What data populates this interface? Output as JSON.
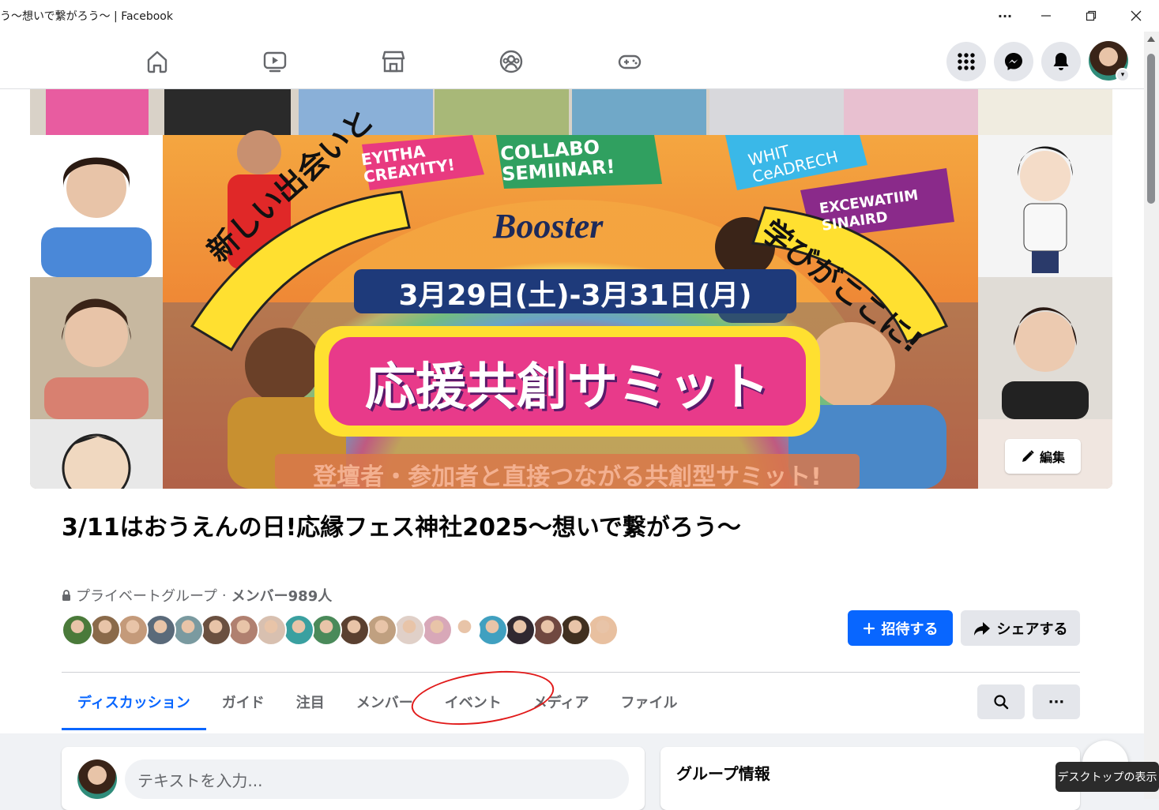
{
  "window": {
    "title": "う〜想いで繋がろう〜 | Facebook",
    "more": "···"
  },
  "navbar": {
    "icons": [
      "home-icon",
      "video-icon",
      "marketplace-icon",
      "groups-icon",
      "gaming-icon"
    ],
    "right_icons": [
      "menu-grid-icon",
      "messenger-icon",
      "bell-icon"
    ]
  },
  "cover": {
    "left_text": "新しい出会いと",
    "right_text": "学びがここに!",
    "logo": "Booster",
    "date": "3月29日(土)-3月31日(月)",
    "headline": "応援共創サミット",
    "subline": "登壇者・参加者と直接つながる共創型サミット!",
    "banner_texts": [
      "EYITHA CREAYITY!",
      "COLLABO SEMIINAR!",
      "WHIT CeADRECH",
      "EXCEWATIIM SINAIRD"
    ],
    "edit_label": "編集"
  },
  "group": {
    "title": "3/11はおうえんの日!応縁フェス神社2025〜想いで繋がろう〜",
    "privacy": "プライベートグループ",
    "separator": "·",
    "members": "メンバー989人",
    "member_colors": [
      "#4a7a3a",
      "#8a6a4a",
      "#c49a7a",
      "#5a6a7a",
      "#7a9aa0",
      "#6a5040",
      "#b08070",
      "#d8c0b0",
      "#3aa0a0",
      "#4a8a5a",
      "#5a4030",
      "#c0a080",
      "#e0d0c8",
      "#d8a8b8",
      "#ffffff",
      "#40a0c0",
      "#302830",
      "#704840",
      "#403020",
      "#e8c0a0"
    ]
  },
  "actions": {
    "invite": "招待する",
    "share": "シェアする"
  },
  "tabs": [
    {
      "label": "ディスカッション",
      "active": true
    },
    {
      "label": "ガイド",
      "active": false
    },
    {
      "label": "注目",
      "active": false
    },
    {
      "label": "メンバー",
      "active": false
    },
    {
      "label": "イベント",
      "active": false
    },
    {
      "label": "メディア",
      "active": false
    },
    {
      "label": "ファイル",
      "active": false
    }
  ],
  "tab_tools": {
    "more": "···"
  },
  "composer": {
    "placeholder": "テキストを入力..."
  },
  "info": {
    "title": "グループ情報"
  },
  "tooltip": "デスクトップの表示",
  "colors": {
    "accent": "#0866ff",
    "annotation": "#e11a1a"
  }
}
